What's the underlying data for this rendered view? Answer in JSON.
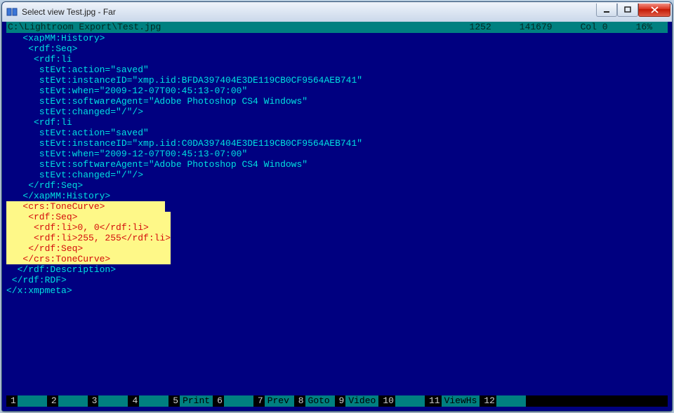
{
  "window": {
    "title": "Select view Test.jpg - Far"
  },
  "statusTop": {
    "path": "C:\\Lightroom Export\\Test.jpg",
    "col1": "1252",
    "col2": "141679",
    "col3": "Col 0",
    "col4": "16%"
  },
  "code": {
    "lines": [
      "   <xapMM:History>",
      "    <rdf:Seq>",
      "     <rdf:li",
      "      stEvt:action=\"saved\"",
      "      stEvt:instanceID=\"xmp.iid:BFDA397404E3DE119CB0CF9564AEB741\"",
      "      stEvt:when=\"2009-12-07T00:45:13-07:00\"",
      "      stEvt:softwareAgent=\"Adobe Photoshop CS4 Windows\"",
      "      stEvt:changed=\"/\"/>",
      "     <rdf:li",
      "      stEvt:action=\"saved\"",
      "      stEvt:instanceID=\"xmp.iid:C0DA397404E3DE119CB0CF9564AEB741\"",
      "      stEvt:when=\"2009-12-07T00:45:13-07:00\"",
      "      stEvt:softwareAgent=\"Adobe Photoshop CS4 Windows\"",
      "      stEvt:changed=\"/\"/>",
      "    </rdf:Seq>",
      "   </xapMM:History>"
    ],
    "selected": [
      "   <crs:ToneCurve>           ",
      "    <rdf:Seq>                 ",
      "     <rdf:li>0, 0</rdf:li>    ",
      "     <rdf:li>255, 255</rdf:li>",
      "    </rdf:Seq>                ",
      "   </crs:ToneCurve>           "
    ],
    "linesAfter": [
      "  </rdf:Description>",
      " </rdf:RDF>",
      "</x:xmpmeta>"
    ]
  },
  "fkeys": [
    {
      "n": "1",
      "lbl": ""
    },
    {
      "n": "2",
      "lbl": ""
    },
    {
      "n": "3",
      "lbl": ""
    },
    {
      "n": "4",
      "lbl": ""
    },
    {
      "n": "5",
      "lbl": "Print"
    },
    {
      "n": "6",
      "lbl": ""
    },
    {
      "n": "7",
      "lbl": "Prev"
    },
    {
      "n": "8",
      "lbl": "Goto"
    },
    {
      "n": "9",
      "lbl": "Video"
    },
    {
      "n": "10",
      "lbl": ""
    },
    {
      "n": "11",
      "lbl": "ViewHs"
    },
    {
      "n": "12",
      "lbl": ""
    }
  ]
}
